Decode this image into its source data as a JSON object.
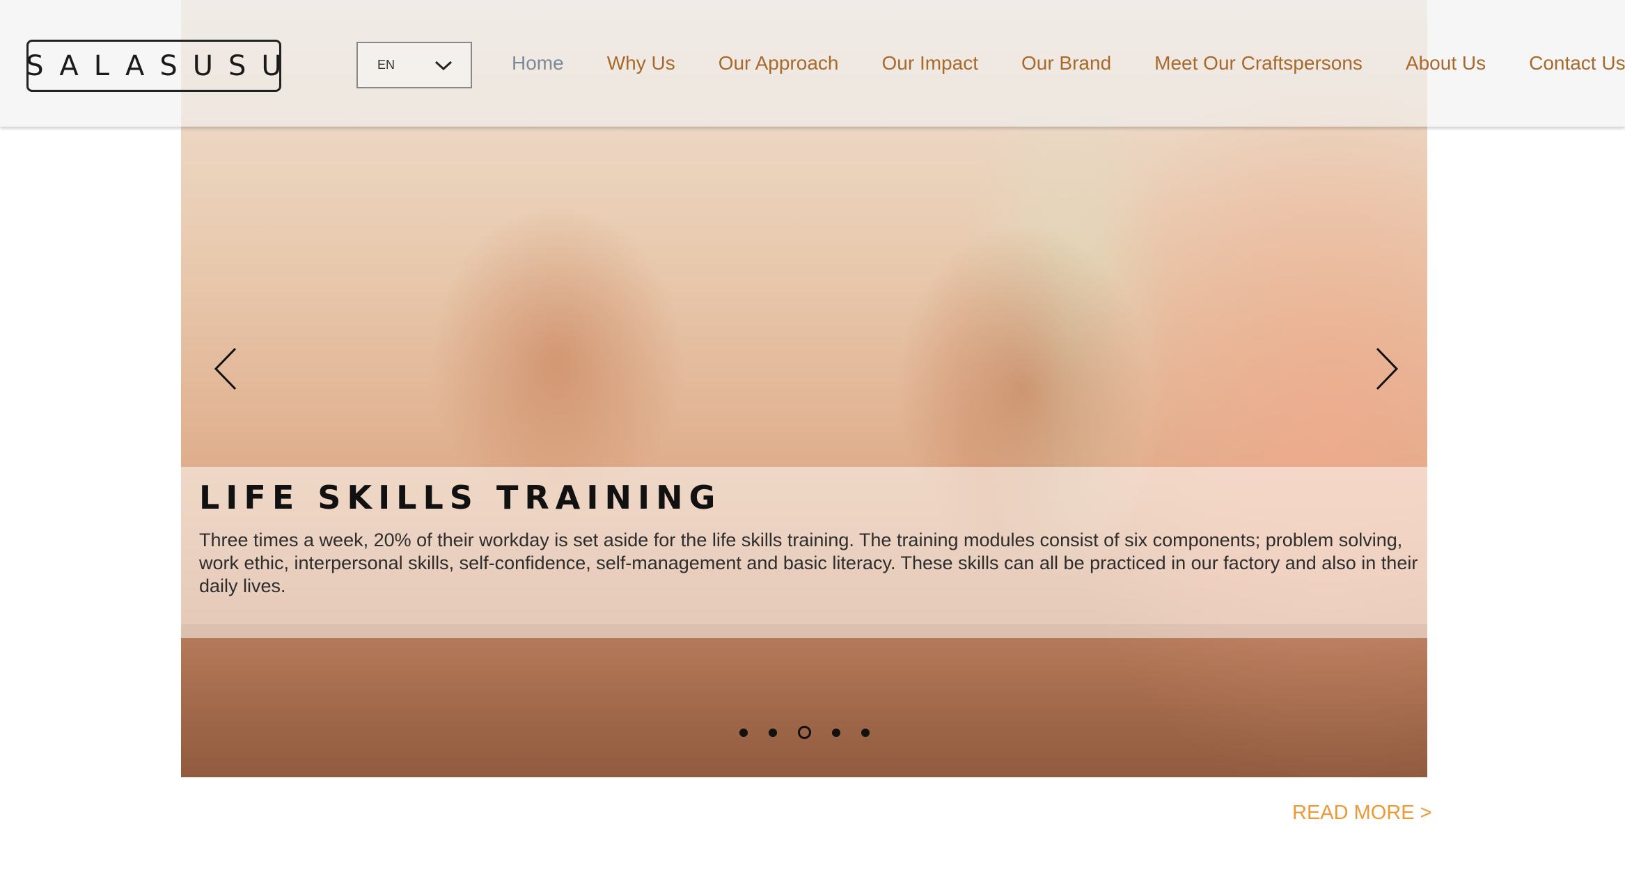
{
  "header": {
    "logo": "SALASUSU",
    "language": {
      "selected": "EN"
    },
    "nav": [
      {
        "label": "Home",
        "current": true
      },
      {
        "label": "Why Us"
      },
      {
        "label": "Our Approach"
      },
      {
        "label": "Our Impact"
      },
      {
        "label": "Our Brand"
      },
      {
        "label": "Meet Our Craftspersons"
      },
      {
        "label": "About Us"
      },
      {
        "label": "Contact Us"
      }
    ]
  },
  "slideshow": {
    "title": "LIFE SKILLS TRAINING",
    "text": "Three times a week, 20% of their workday is set aside for the life skills training. The training modules consist of six components; problem solving, work ethic, interpersonal skills, self-confidence, self-management and basic literacy. These skills can all be practiced in our factory and also in their daily lives.",
    "slide_count": 5,
    "active_slide": 3,
    "prev_icon": "chevron-left-icon",
    "next_icon": "chevron-right-icon"
  },
  "read_more": "READ MORE >",
  "colors": {
    "nav_text": "#a8692a",
    "nav_current": "#7d8a96",
    "read_more": "#ee9a34",
    "title": "#111111"
  }
}
